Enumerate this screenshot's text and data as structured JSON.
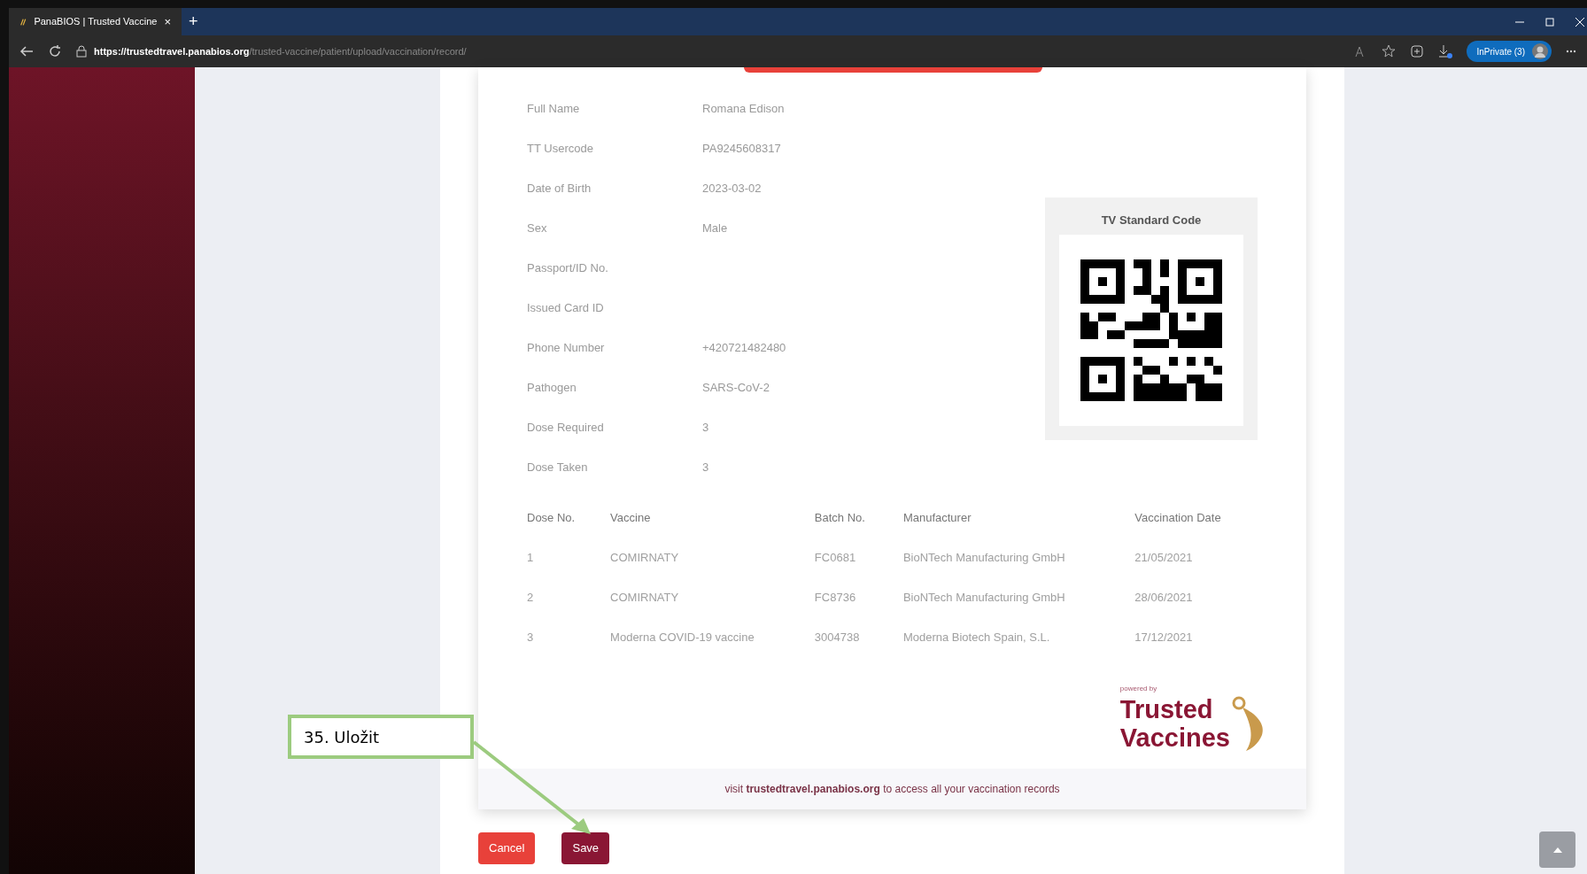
{
  "browser": {
    "tab_title": "PanaBIOS | Trusted Vaccine",
    "tab_close": "×",
    "new_tab": "+",
    "url_host": "https://trustedtravel.panabios.org",
    "url_path": "/trusted-vaccine/patient/upload/vaccination/record/",
    "profile_label": "InPrivate (3)"
  },
  "details": [
    {
      "label": "Full Name",
      "value": "Romana Edison"
    },
    {
      "label": "TT Usercode",
      "value": "PA9245608317"
    },
    {
      "label": "Date of Birth",
      "value": "2023-03-02"
    },
    {
      "label": "Sex",
      "value": "Male"
    },
    {
      "label": "Passport/ID No."
    },
    {
      "label": "Issued Card ID"
    },
    {
      "label": "Phone Number",
      "value": "+420721482480"
    },
    {
      "label": "Pathogen",
      "value": "SARS-CoV-2"
    },
    {
      "label": "Dose Required",
      "value": "3"
    },
    {
      "label": "Dose Taken",
      "value": "3"
    }
  ],
  "qr": {
    "title": "TV Standard Code"
  },
  "table": {
    "columns": [
      "Dose No.",
      "Vaccine",
      "Batch No.",
      "Manufacturer",
      "Vaccination Date"
    ],
    "rows": [
      [
        "1",
        "COMIRNATY",
        "FC0681",
        "BioNTech Manufacturing GmbH",
        "21/05/2021"
      ],
      [
        "2",
        "COMIRNATY",
        "FC8736",
        "BioNTech Manufacturing GmbH",
        "28/06/2021"
      ],
      [
        "3",
        "Moderna COVID-19 vaccine",
        "3004738",
        "Moderna Biotech Spain, S.L.",
        "17/12/2021"
      ]
    ]
  },
  "branding": {
    "powered_by": "powered by",
    "logo_lines": [
      "Trusted",
      "Vaccines"
    ]
  },
  "footer_note": "visit **trustedtravel.panabios.org** to access all your vaccination records",
  "buttons": [
    {
      "label": "Cancel",
      "kind": "cancel"
    },
    {
      "label": "Save",
      "kind": "save"
    }
  ],
  "annotation": "35. Uložit"
}
